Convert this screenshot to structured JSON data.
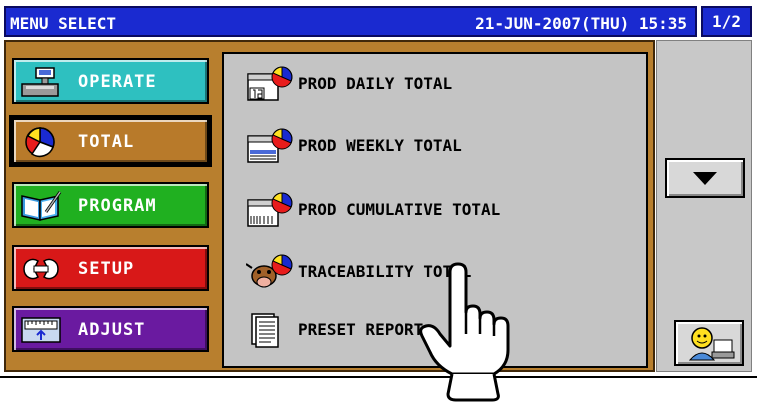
{
  "title_bar": {
    "title": "MENU SELECT",
    "datetime": "21-JUN-2007(THU) 15:35",
    "page": "1/2"
  },
  "left_menu": [
    {
      "label": "OPERATE",
      "icon": "scale-icon",
      "color": "#2ec0c0"
    },
    {
      "label": "TOTAL",
      "icon": "pie-chart-icon",
      "color": "#b87a2a"
    },
    {
      "label": "PROGRAM",
      "icon": "book-pen-icon",
      "color": "#20b020"
    },
    {
      "label": "SETUP",
      "icon": "wrench-icon",
      "color": "#d81818"
    },
    {
      "label": "ADJUST",
      "icon": "calibration-icon",
      "color": "#6a1aa0"
    }
  ],
  "main_menu": [
    {
      "label": "PROD DAILY TOTAL",
      "icon": "daily-calendar-icon"
    },
    {
      "label": "PROD WEEKLY TOTAL",
      "icon": "weekly-calendar-icon"
    },
    {
      "label": "PROD CUMULATIVE TOTAL",
      "icon": "cumulative-calendar-icon"
    },
    {
      "label": "TRACEABILITY TOTAL",
      "icon": "cow-icon"
    },
    {
      "label": "PRESET REPORT",
      "icon": "document-icon"
    }
  ],
  "buttons": {
    "scroll_down": "down-arrow-icon",
    "user": "user-terminal-icon"
  },
  "colors": {
    "title_bar": "#1a2ad0",
    "frame": "#b87f2e",
    "panel": "#c4c4c4"
  }
}
